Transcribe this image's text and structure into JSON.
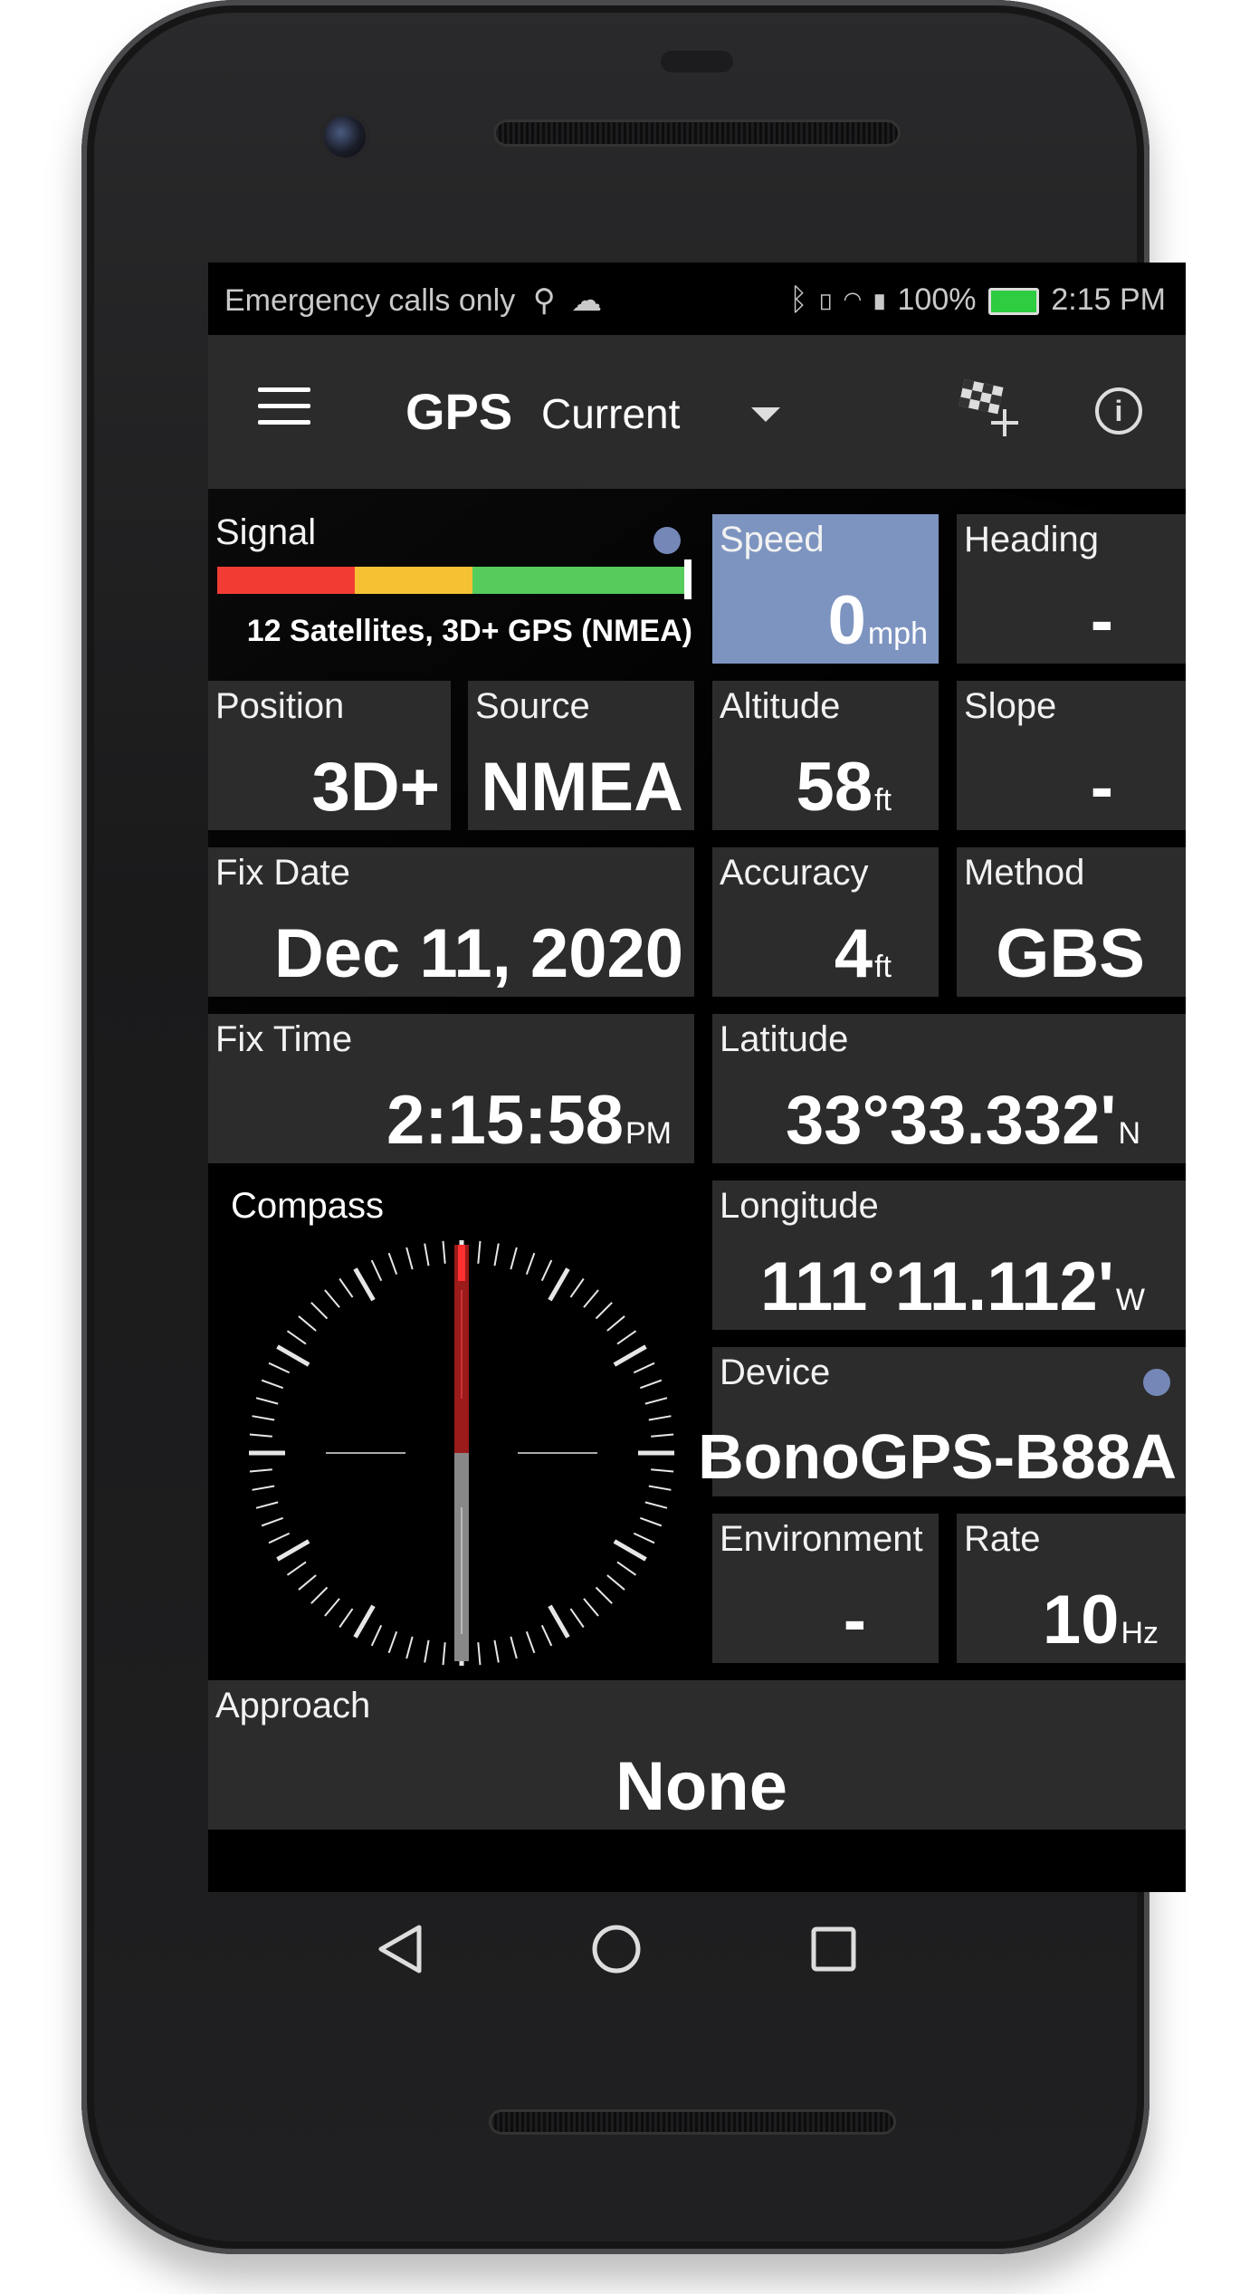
{
  "status_bar": {
    "left_text": "Emergency calls only",
    "battery": "100%",
    "time": "2:15 PM",
    "icons": [
      "usb-icon",
      "cloud-icon",
      "bluetooth-icon",
      "vibrate-icon",
      "wifi-icon",
      "sd-icon",
      "battery-icon"
    ]
  },
  "toolbar": {
    "title": "GPS",
    "subtitle": "Current",
    "icons": [
      "menu-icon",
      "dropdown-arrow-icon",
      "checkered-flag-add-icon",
      "info-icon"
    ]
  },
  "tiles": {
    "signal": {
      "label": "Signal",
      "summary": "12 Satellites, 3D+ GPS (NMEA)",
      "level": 1.0,
      "bar_colors": [
        "#f23c33",
        "#f6c234",
        "#55cc5b"
      ]
    },
    "speed": {
      "label": "Speed",
      "value": "0",
      "unit": "mph"
    },
    "heading": {
      "label": "Heading",
      "value": "-"
    },
    "position": {
      "label": "Position",
      "value": "3D+"
    },
    "source": {
      "label": "Source",
      "value": "NMEA"
    },
    "altitude": {
      "label": "Altitude",
      "value": "58",
      "unit": "ft"
    },
    "slope": {
      "label": "Slope",
      "value": "-"
    },
    "fix_date": {
      "label": "Fix Date",
      "value": "Dec 11, 2020"
    },
    "accuracy": {
      "label": "Accuracy",
      "value": "4",
      "unit": "ft"
    },
    "method": {
      "label": "Method",
      "value": "GBS"
    },
    "fix_time": {
      "label": "Fix Time",
      "value": "2:15:58",
      "unit": "PM"
    },
    "latitude": {
      "label": "Latitude",
      "value": "33°33.332'",
      "unit": "N"
    },
    "longitude": {
      "label": "Longitude",
      "value": "111°11.112'",
      "unit": "W"
    },
    "device": {
      "label": "Device",
      "value": "BonoGPS-B88A"
    },
    "environment": {
      "label": "Environment",
      "value": "-"
    },
    "rate": {
      "label": "Rate",
      "value": "10",
      "unit": "Hz"
    },
    "approach": {
      "label": "Approach",
      "value": "None"
    }
  },
  "compass": {
    "label": "Compass",
    "heading_deg": 0
  },
  "colors": {
    "speed_tile": "#7d94c0",
    "tile_bg": "#2c2c2c",
    "toolbar_bg": "#2b2b2b",
    "dot": "#7487b7"
  },
  "nav": {
    "icons": [
      "back-icon",
      "home-icon",
      "recents-icon"
    ]
  }
}
